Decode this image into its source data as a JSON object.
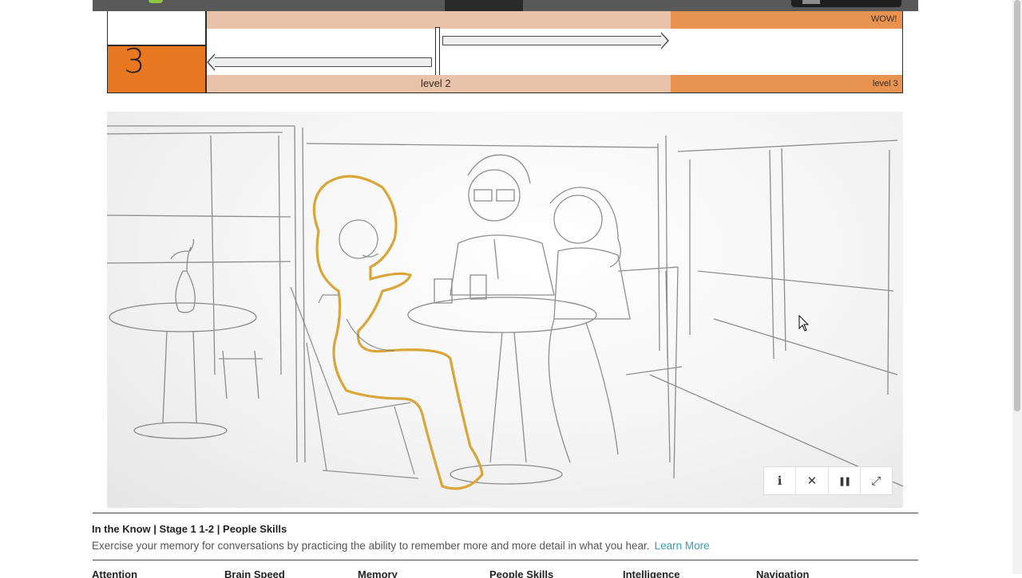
{
  "level_panel": {
    "score": "3",
    "wow_label": "WOW!",
    "level_left_label": "level 2",
    "level_right_label": "level 3",
    "colors": {
      "score_fill": "#e87722",
      "level2": "#e8c3aa",
      "level3": "#e89450"
    }
  },
  "game": {
    "controls": [
      {
        "name": "info-button",
        "icon": "info-icon",
        "glyph": "ℹ"
      },
      {
        "name": "close-button",
        "icon": "close-icon",
        "glyph": "✕"
      },
      {
        "name": "pause-button",
        "icon": "pause-icon",
        "glyph": "❚❚"
      },
      {
        "name": "fullscreen-button",
        "icon": "expand-icon",
        "glyph": "⤢"
      }
    ]
  },
  "caption": {
    "title": "In the Know | Stage 1 1-2 | People Skills",
    "description": "Exercise your memory for conversations by practicing the ability to remember more and more detail in what you hear.",
    "link": "Learn More"
  },
  "categories": [
    "Attention",
    "Brain Speed",
    "Memory",
    "People Skills",
    "Intelligence",
    "Navigation"
  ]
}
